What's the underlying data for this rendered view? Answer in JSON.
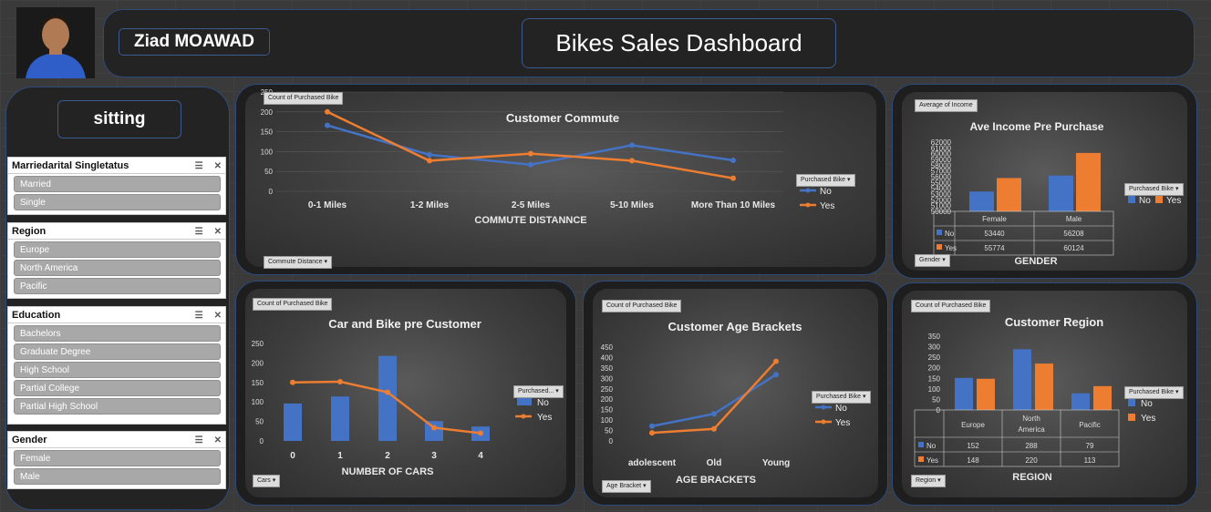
{
  "header": {
    "name": "Ziad MOAWAD",
    "title": "Bikes Sales Dashboard"
  },
  "sidebar": {
    "title": "sitting",
    "slicers": [
      {
        "label": "Marriedarital Singletatus",
        "items": [
          "Married",
          "Single"
        ]
      },
      {
        "label": "Region",
        "items": [
          "Europe",
          "North America",
          "Pacific"
        ]
      },
      {
        "label": "Education",
        "items": [
          "Bachelors",
          "Graduate Degree",
          "High School",
          "Partial College",
          "Partial High School"
        ]
      },
      {
        "label": "Gender",
        "items": [
          "Female",
          "Male"
        ]
      }
    ]
  },
  "colors": {
    "no": "#4472c4",
    "yes": "#ed7d31"
  },
  "chart_data": [
    {
      "id": "commute",
      "type": "line",
      "title": "Customer Commute",
      "field_tag": "Count of Purchased Bike",
      "filter_tag": "Commute Distance",
      "legend_tag": "Purchased Bike",
      "xlabel": "COMMUTE DISTANNCE",
      "categories": [
        "0-1 Miles",
        "1-2 Miles",
        "2-5 Miles",
        "5-10 Miles",
        "More Than 10 Miles"
      ],
      "ylim": [
        0,
        250
      ],
      "yticks": [
        0,
        50,
        100,
        150,
        200,
        250
      ],
      "series": [
        {
          "name": "No",
          "values": [
            166,
            92,
            67,
            116,
            78
          ]
        },
        {
          "name": "Yes",
          "values": [
            200,
            77,
            95,
            77,
            33
          ]
        }
      ]
    },
    {
      "id": "income",
      "type": "bar",
      "title": "Ave Income Pre Purchase",
      "field_tag": "Average of Income",
      "filter_tag": "Gender",
      "legend_tag": "Purchased Bike",
      "xlabel": "GENDER",
      "categories": [
        "Female",
        "Male"
      ],
      "ylim": [
        50000,
        62000
      ],
      "yticks": [
        50000,
        51000,
        52000,
        53000,
        54000,
        55000,
        56000,
        57000,
        58000,
        59000,
        60000,
        61000,
        62000
      ],
      "series": [
        {
          "name": "No",
          "values": [
            53440,
            56208
          ]
        },
        {
          "name": "Yes",
          "values": [
            55774,
            60124
          ]
        }
      ]
    },
    {
      "id": "cars",
      "type": "bar+line",
      "title": "Car and Bike pre Customer",
      "field_tag": "Count of Purchased Bike",
      "filter_tag": "Cars",
      "legend_tag": "Purchased...",
      "xlabel": "NUMBER OF CARS",
      "categories": [
        "0",
        "1",
        "2",
        "3",
        "4"
      ],
      "ylim": [
        0,
        250
      ],
      "yticks": [
        0,
        50,
        100,
        150,
        200,
        250
      ],
      "series": [
        {
          "name": "No",
          "values": [
            96,
            114,
            218,
            51,
            37
          ]
        },
        {
          "name": "Yes",
          "values": [
            150,
            152,
            125,
            34,
            20
          ]
        }
      ]
    },
    {
      "id": "age",
      "type": "line",
      "title": "Customer Age Brackets",
      "field_tag": "Count of Purchased Bike",
      "filter_tag": "Age Bracket",
      "legend_tag": "Purchased Bike",
      "xlabel": "AGE BRACKETS",
      "categories": [
        "adolescent",
        "Old",
        "Young"
      ],
      "ylim": [
        0,
        450
      ],
      "yticks": [
        0,
        50,
        100,
        150,
        200,
        250,
        300,
        350,
        400,
        450
      ],
      "series": [
        {
          "name": "No",
          "values": [
            71,
            130,
            318
          ]
        },
        {
          "name": "Yes",
          "values": [
            39,
            58,
            382
          ]
        }
      ]
    },
    {
      "id": "region",
      "type": "bar",
      "title": "Customer Region",
      "field_tag": "Count of Purchased Bike",
      "filter_tag": "Region",
      "legend_tag": "Purchased Bike",
      "xlabel": "REGION",
      "categories": [
        "Europe",
        "North America",
        "Pacific"
      ],
      "ylim": [
        0,
        350
      ],
      "yticks": [
        0,
        50,
        100,
        150,
        200,
        250,
        300,
        350
      ],
      "series": [
        {
          "name": "No",
          "values": [
            152,
            288,
            79
          ]
        },
        {
          "name": "Yes",
          "values": [
            148,
            220,
            113
          ]
        }
      ]
    }
  ]
}
